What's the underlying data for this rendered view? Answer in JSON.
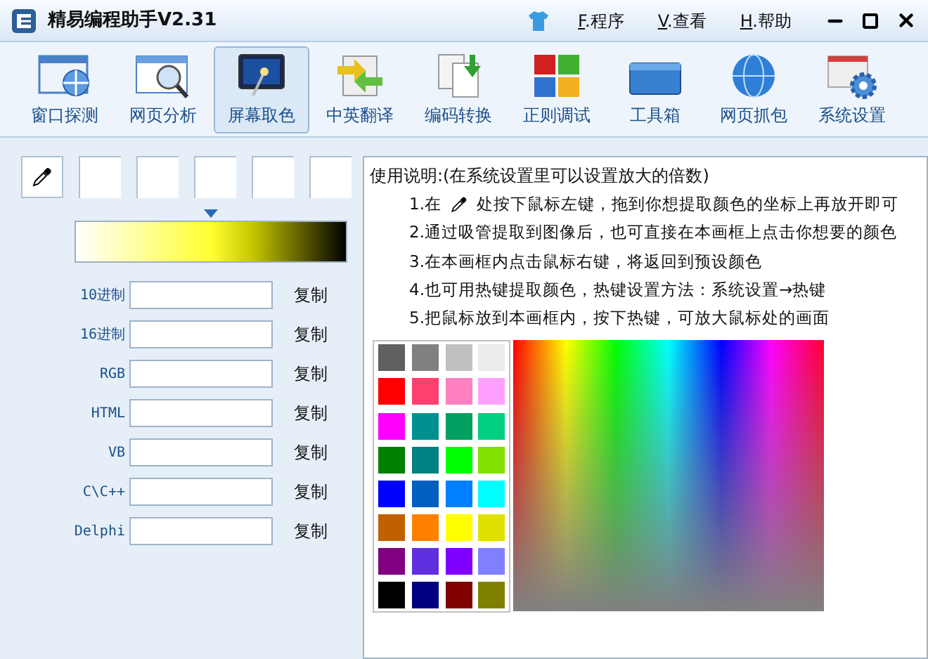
{
  "window": {
    "title": "精易编程助手V2.31"
  },
  "menu": [
    {
      "key": "F",
      "label": ".程序"
    },
    {
      "key": "V",
      "label": ".查看"
    },
    {
      "key": "H",
      "label": ".帮助"
    }
  ],
  "toolbar": [
    {
      "label": "窗口探测",
      "selected": false
    },
    {
      "label": "网页分析",
      "selected": false
    },
    {
      "label": "屏幕取色",
      "selected": true
    },
    {
      "label": "中英翻译",
      "selected": false
    },
    {
      "label": "编码转换",
      "selected": false
    },
    {
      "label": "正则调试",
      "selected": false
    },
    {
      "label": "工具箱",
      "selected": false
    },
    {
      "label": "网页抓包",
      "selected": false
    },
    {
      "label": "系统设置",
      "selected": false
    }
  ],
  "formats": [
    {
      "label": "10进制",
      "button": "复制"
    },
    {
      "label": "16进制",
      "button": "复制"
    },
    {
      "label": "RGB",
      "button": "复制"
    },
    {
      "label": "HTML",
      "button": "复制"
    },
    {
      "label": "VB",
      "button": "复制"
    },
    {
      "label": "C\\C++",
      "button": "复制"
    },
    {
      "label": "Delphi",
      "button": "复制"
    }
  ],
  "help": {
    "title": "使用说明:(在系统设置里可以设置放大的倍数)",
    "steps": [
      {
        "kind": "icon",
        "before": "1.在",
        "after": "处按下鼠标左键，拖到你想提取颜色的坐标上再放开即可"
      },
      {
        "kind": "text",
        "text": "2.通过吸管提取到图像后，也可直接在本画框上点击你想要的颜色"
      },
      {
        "kind": "text",
        "text": "3.在本画框内点击鼠标右键，将返回到预设颜色"
      },
      {
        "kind": "text",
        "text": "4.也可用热键提取颜色，热键设置方法：系统设置→热键"
      },
      {
        "kind": "text",
        "text": "5.把鼠标放到本画框内，按下热键，可放大鼠标处的画面"
      }
    ]
  },
  "swatches": [
    {
      "color": "#606060"
    },
    {
      "color": "#808080"
    },
    {
      "color": "#c0c0c0"
    },
    {
      "color": "#ececec"
    },
    {
      "color": "#ff0000"
    },
    {
      "color": "#ff4070"
    },
    {
      "color": "#ff80c0"
    },
    {
      "color": "#ffa0ff"
    },
    {
      "color": "#ff00ff"
    },
    {
      "color": "#009090"
    },
    {
      "color": "#00a060"
    },
    {
      "color": "#00d080"
    },
    {
      "color": "#008000"
    },
    {
      "color": "#008080"
    },
    {
      "color": "#00ff00"
    },
    {
      "color": "#80e000"
    },
    {
      "color": "#0000ff"
    },
    {
      "color": "#0060c0"
    },
    {
      "color": "#0080ff"
    },
    {
      "color": "#00ffff"
    },
    {
      "color": "#c06000"
    },
    {
      "color": "#ff8000"
    },
    {
      "color": "#ffff00"
    },
    {
      "color": "#e0e000"
    },
    {
      "color": "#800080"
    },
    {
      "color": "#6030e0"
    },
    {
      "color": "#8000ff"
    },
    {
      "color": "#8080ff"
    },
    {
      "color": "#000000"
    },
    {
      "color": "#000080"
    },
    {
      "color": "#800000"
    },
    {
      "color": "#808000"
    }
  ]
}
